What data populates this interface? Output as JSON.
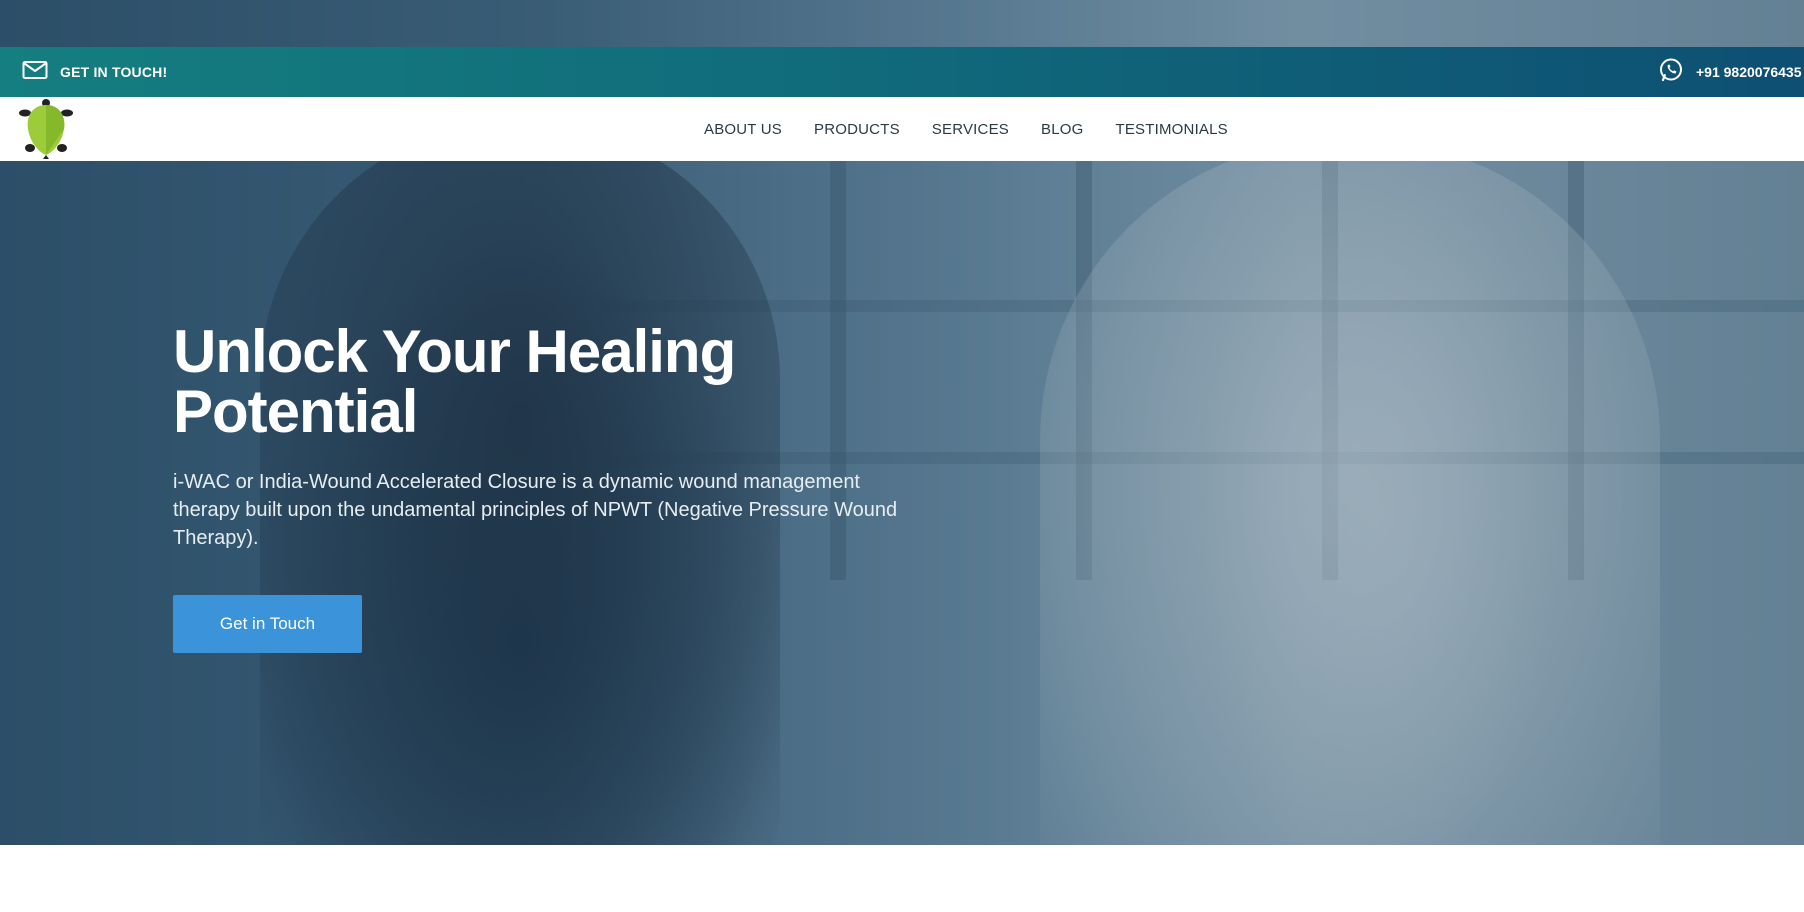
{
  "topbar": {
    "contact_label": "GET IN TOUCH!",
    "phone_number": "+91 9820076435",
    "gradient": [
      "#157e80",
      "#0e4f73"
    ]
  },
  "nav": {
    "items": [
      {
        "label": "ABOUT US"
      },
      {
        "label": "PRODUCTS"
      },
      {
        "label": "SERVICES"
      },
      {
        "label": "BLOG"
      },
      {
        "label": "TESTIMONIALS"
      }
    ]
  },
  "hero": {
    "title": "Unlock Your Healing Potential",
    "description": "i-WAC or India-Wound Accelerated Closure is a dynamic wound management therapy built upon the undamental principles of NPWT (Negative Pressure Wound Therapy).",
    "cta_label": "Get in Touch"
  },
  "colors": {
    "accent": "#3b94d9",
    "nav_text": "#2a3a44",
    "logo_green": "#9ccc3a"
  },
  "icons": {
    "contact": "mail-icon",
    "phone": "whatsapp-icon",
    "logo": "turtle-logo-icon"
  }
}
